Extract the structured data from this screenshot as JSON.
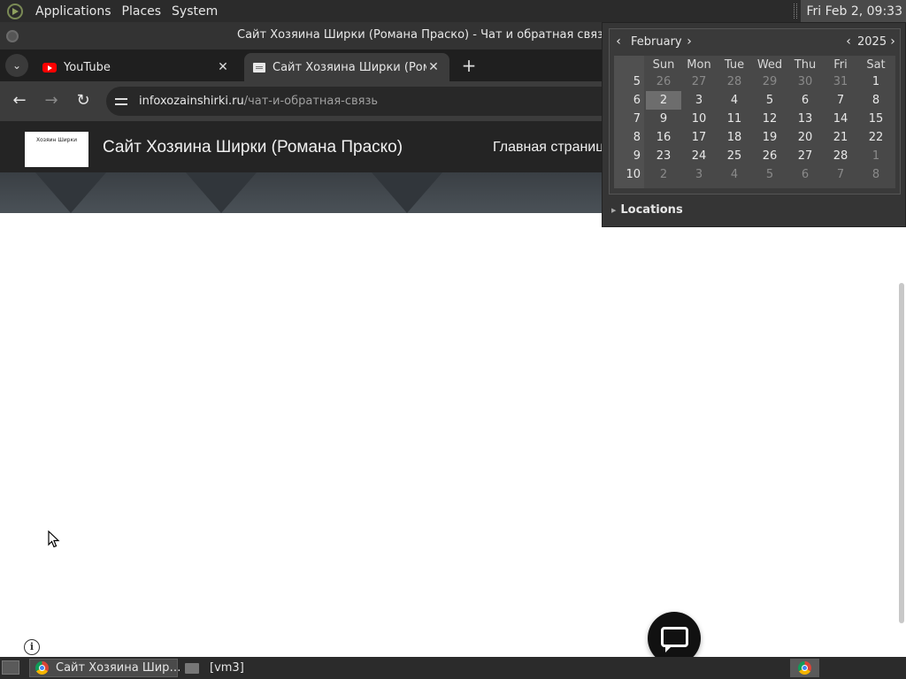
{
  "top_panel": {
    "menus": [
      "Applications",
      "Places",
      "System"
    ],
    "clock": "Fri Feb  2, 09:33"
  },
  "window": {
    "title": "Сайт Хозяина Ширки (Романа Праско) - Чат и обратная связь - Go"
  },
  "tabs": [
    {
      "label": "YouTube",
      "icon": "youtube-icon"
    },
    {
      "label": "Сайт Хозяина Ширки (Рома",
      "icon": "page-icon"
    }
  ],
  "address_bar": {
    "host": "infoxozainshirki.ru",
    "path": "/чат-и-обратная-связь"
  },
  "site": {
    "logo_text": "Хозяин Ширки",
    "title": "Сайт Хозяина Ширки (Романа Праско)",
    "nav_item": "Главная страниц"
  },
  "calendar": {
    "month": "February",
    "year": "2025",
    "weekdays": [
      "Sun",
      "Mon",
      "Tue",
      "Wed",
      "Thu",
      "Fri",
      "Sat"
    ],
    "weeks": [
      {
        "num": "5",
        "days": [
          [
            "26",
            "dim"
          ],
          [
            "27",
            "dim"
          ],
          [
            "28",
            "dim"
          ],
          [
            "29",
            "dim"
          ],
          [
            "30",
            "dim"
          ],
          [
            "31",
            "dim"
          ],
          [
            "1",
            ""
          ]
        ]
      },
      {
        "num": "6",
        "days": [
          [
            "2",
            "today"
          ],
          [
            "3",
            ""
          ],
          [
            "4",
            ""
          ],
          [
            "5",
            ""
          ],
          [
            "6",
            ""
          ],
          [
            "7",
            ""
          ],
          [
            "8",
            ""
          ]
        ]
      },
      {
        "num": "7",
        "days": [
          [
            "9",
            ""
          ],
          [
            "10",
            ""
          ],
          [
            "11",
            ""
          ],
          [
            "12",
            ""
          ],
          [
            "13",
            ""
          ],
          [
            "14",
            ""
          ],
          [
            "15",
            ""
          ]
        ]
      },
      {
        "num": "8",
        "days": [
          [
            "16",
            ""
          ],
          [
            "17",
            ""
          ],
          [
            "18",
            ""
          ],
          [
            "19",
            ""
          ],
          [
            "20",
            ""
          ],
          [
            "21",
            ""
          ],
          [
            "22",
            ""
          ]
        ]
      },
      {
        "num": "9",
        "days": [
          [
            "23",
            ""
          ],
          [
            "24",
            ""
          ],
          [
            "25",
            ""
          ],
          [
            "26",
            ""
          ],
          [
            "27",
            ""
          ],
          [
            "28",
            ""
          ],
          [
            "1",
            "dim"
          ]
        ]
      },
      {
        "num": "10",
        "days": [
          [
            "2",
            "dim"
          ],
          [
            "3",
            "dim"
          ],
          [
            "4",
            "dim"
          ],
          [
            "5",
            "dim"
          ],
          [
            "6",
            "dim"
          ],
          [
            "7",
            "dim"
          ],
          [
            "8",
            "dim"
          ]
        ]
      }
    ],
    "locations_label": "Locations"
  },
  "taskbar": {
    "items": [
      {
        "label": "Сайт Хозяина Шир…",
        "icon": "chrome-icon"
      },
      {
        "label": "[vm3]",
        "icon": "folder-icon"
      }
    ]
  }
}
